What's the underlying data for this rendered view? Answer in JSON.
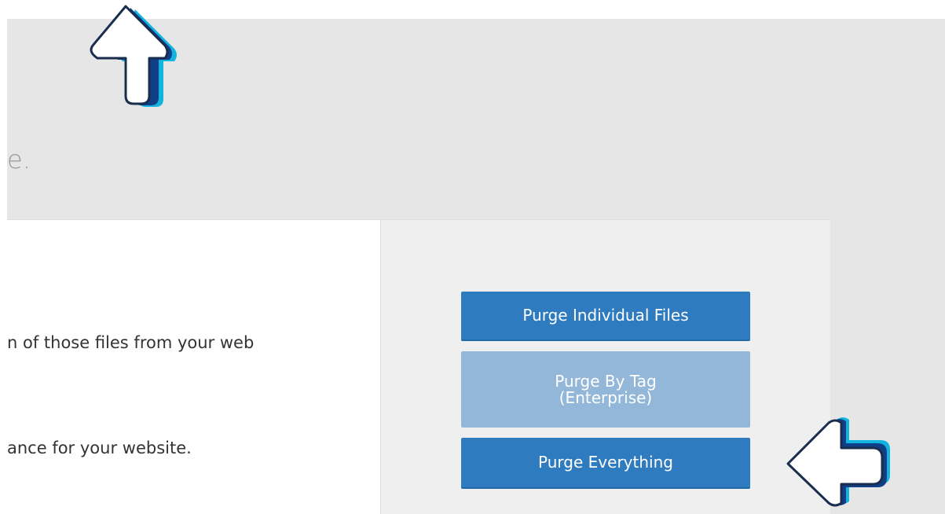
{
  "header": {
    "heading_fragment": "e."
  },
  "main": {
    "description_lines": [
      "n of those files from your web",
      "ance for your website."
    ]
  },
  "actions": {
    "purge_individual_label": "Purge Individual Files",
    "purge_by_tag_line1": "Purge By Tag",
    "purge_by_tag_line2": "(Enterprise)",
    "purge_everything_label": "Purge Everything"
  },
  "annotations": {
    "up_arrow_icon": "arrow-up-icon",
    "left_arrow_icon": "arrow-left-icon",
    "arrow_accent_color": "#1aa7d9"
  },
  "colors": {
    "button_primary": "#2f7bbf",
    "button_disabled": "#93b7d9",
    "band_background": "#e6e6e6",
    "actions_background": "#efefef"
  }
}
